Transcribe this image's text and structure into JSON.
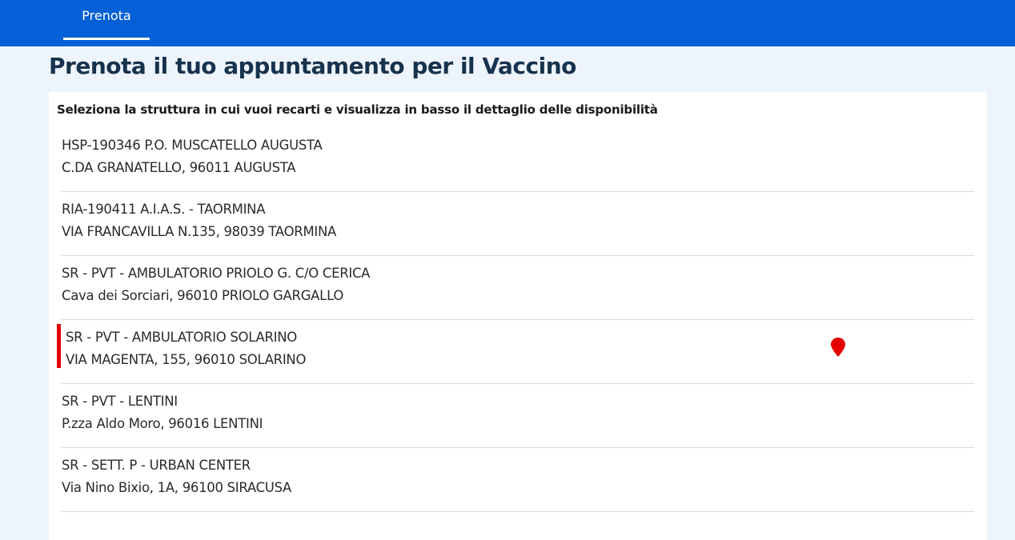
{
  "nav": {
    "tab_label": "Prenota"
  },
  "page": {
    "title": "Prenota il tuo appuntamento per il Vaccino",
    "instruction": "Seleziona la struttura in cui vuoi recarti e visualizza in basso il dettaglio delle disponibilità"
  },
  "colors": {
    "topbar": "#0360d6",
    "title": "#17324d",
    "selection": "#e50000",
    "background": "#eef4fc"
  },
  "locations": [
    {
      "name": "HSP-190346 P.O. MUSCATELLO AUGUSTA",
      "address": "C.DA GRANATELLO, 96011 AUGUSTA"
    },
    {
      "name": "RIA-190411 A.I.A.S. - TAORMINA",
      "address": "VIA FRANCAVILLA N.135, 98039 TAORMINA"
    },
    {
      "name": "SR - PVT - AMBULATORIO PRIOLO G. C/O CERICA",
      "address": "Cava dei Sorciari, 96010 PRIOLO GARGALLO"
    },
    {
      "name": "SR - PVT - AMBULATORIO SOLARINO",
      "address": "VIA MAGENTA, 155, 96010 SOLARINO",
      "selected": true,
      "icon": "map-pin-icon"
    },
    {
      "name": "SR - PVT - LENTINI",
      "address": "P.zza Aldo Moro, 96016 LENTINI"
    },
    {
      "name": "SR - SETT. P - URBAN CENTER",
      "address": "Via Nino Bixio, 1A, 96100 SIRACUSA"
    }
  ]
}
